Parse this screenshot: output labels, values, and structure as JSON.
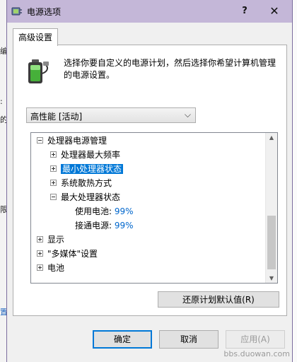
{
  "window": {
    "title": "电源选项",
    "help_label": "?",
    "close_label": "✕"
  },
  "tabs": [
    {
      "label": "高级设置"
    }
  ],
  "description": "选择你要自定义的电源计划，然后选择你希望计算机管理的电源设置。",
  "plan_select": {
    "value": "高性能 [活动]"
  },
  "tree": {
    "processor_power": "处理器电源管理",
    "max_freq": "处理器最大频率",
    "min_state": "最小处理器状态",
    "cooling": "系统散热方式",
    "max_state": "最大处理器状态",
    "on_battery_label": "使用电池:",
    "on_battery_value": "99%",
    "plugged_label": "接通电源:",
    "plugged_value": "99%",
    "display": "显示",
    "multimedia": "\"多媒体\"设置",
    "battery": "电池"
  },
  "buttons": {
    "restore": "还原计划默认值(R)",
    "ok": "确定",
    "cancel": "取消",
    "apply": "应用(A)"
  },
  "background": {
    "left_chars": [
      "编",
      ":",
      "的",
      "限",
      "置"
    ]
  },
  "watermark": "bbs.duowan.com",
  "colors": {
    "titlebar": "#c4b7d8",
    "selection": "#0078d7",
    "value_text": "#0066cc"
  },
  "icons": {
    "title_icon": "power-options-icon",
    "battery_icon": "battery-plug-icon"
  }
}
